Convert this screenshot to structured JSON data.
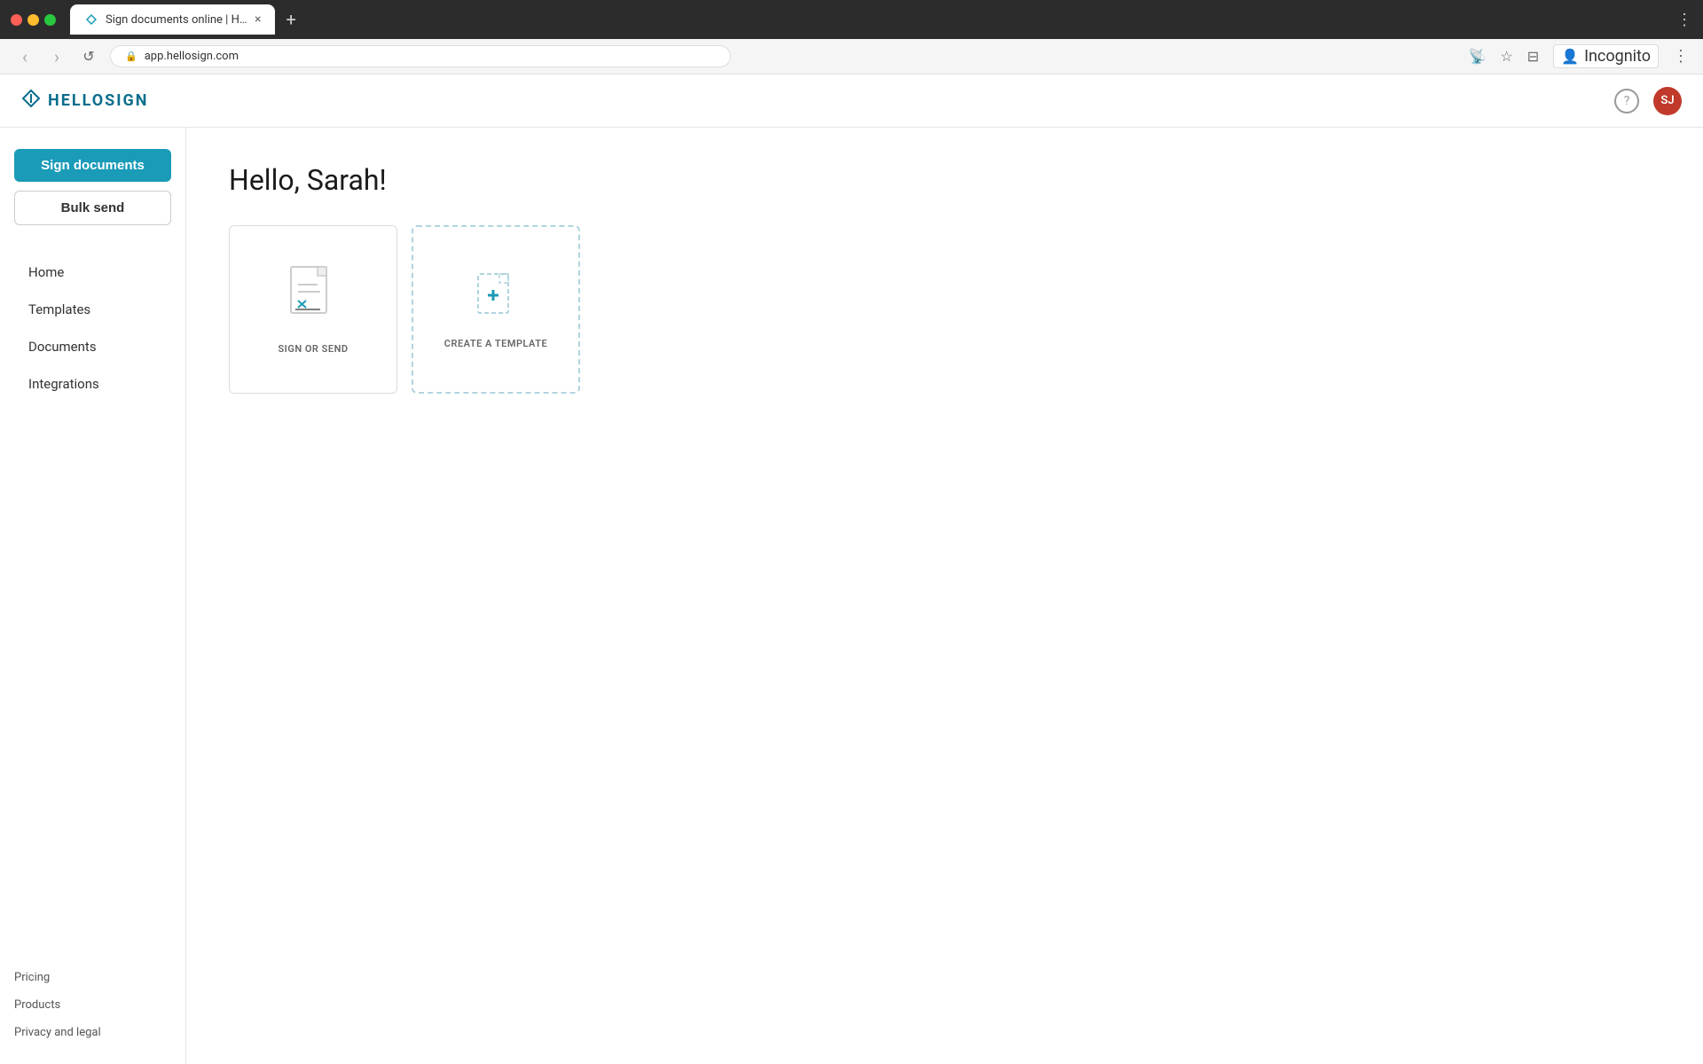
{
  "browser": {
    "tab_title": "Sign documents online | Hello S",
    "tab_close": "×",
    "tab_new": "+",
    "address": "app.hellosign.com",
    "more_icon": "⋮",
    "nav_back": "‹",
    "nav_forward": "›",
    "nav_refresh": "↺",
    "incognito_label": "Incognito",
    "incognito_avatar": ""
  },
  "header": {
    "logo_text": "HELLOSIGN",
    "help_label": "?",
    "avatar_initials": "SJ"
  },
  "sidebar": {
    "sign_documents_label": "Sign documents",
    "bulk_send_label": "Bulk send",
    "nav_items": [
      {
        "id": "home",
        "label": "Home"
      },
      {
        "id": "templates",
        "label": "Templates"
      },
      {
        "id": "documents",
        "label": "Documents"
      },
      {
        "id": "integrations",
        "label": "Integrations"
      }
    ],
    "footer_links": [
      {
        "id": "pricing",
        "label": "Pricing"
      },
      {
        "id": "products",
        "label": "Products"
      },
      {
        "id": "privacy",
        "label": "Privacy and legal"
      }
    ]
  },
  "main": {
    "greeting": "Hello, Sarah!",
    "cards": [
      {
        "id": "sign-or-send",
        "label": "SIGN OR SEND"
      },
      {
        "id": "create-template",
        "label": "CREATE A TEMPLATE"
      }
    ]
  },
  "colors": {
    "primary": "#1a9bb8",
    "logo": "#0b6e8d",
    "avatar_bg": "#c0392b"
  }
}
